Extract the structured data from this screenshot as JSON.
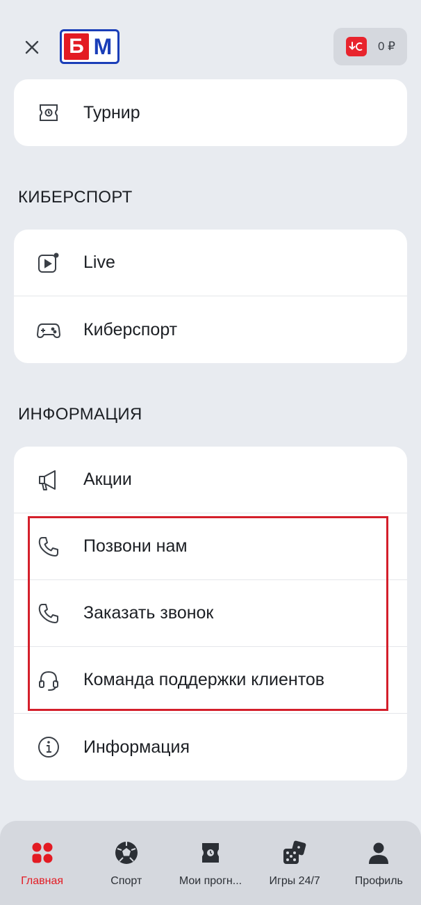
{
  "header": {
    "logo_left": "Б",
    "logo_right": "М",
    "balance": "0 ₽"
  },
  "top_card": {
    "items": [
      {
        "label": "Турнир",
        "icon": "tournament-icon"
      }
    ]
  },
  "esports": {
    "title": "КИБЕРСПОРТ",
    "items": [
      {
        "label": "Live",
        "icon": "live-icon"
      },
      {
        "label": "Киберспорт",
        "icon": "gamepad-icon"
      }
    ]
  },
  "info": {
    "title": "ИНФОРМАЦИЯ",
    "items": [
      {
        "label": "Акции",
        "icon": "megaphone-icon"
      },
      {
        "label": "Позвони нам",
        "icon": "phone-icon"
      },
      {
        "label": "Заказать звонок",
        "icon": "phone-icon"
      },
      {
        "label": "Команда поддержки клиентов",
        "icon": "headset-icon"
      },
      {
        "label": "Информация",
        "icon": "info-icon"
      }
    ]
  },
  "nav": {
    "items": [
      {
        "label": "Главная",
        "icon": "home-grid-icon",
        "active": true
      },
      {
        "label": "Спорт",
        "icon": "soccer-ball-icon",
        "active": false
      },
      {
        "label": "Мои прогн...",
        "icon": "tickets-icon",
        "active": false
      },
      {
        "label": "Игры 24/7",
        "icon": "dice-icon",
        "active": false
      },
      {
        "label": "Профиль",
        "icon": "user-icon",
        "active": false
      }
    ]
  },
  "colors": {
    "accent": "#e31b23",
    "logo_blue": "#1a3eb8",
    "background": "#e8ebf0",
    "highlight_box": "#d41f2b"
  }
}
